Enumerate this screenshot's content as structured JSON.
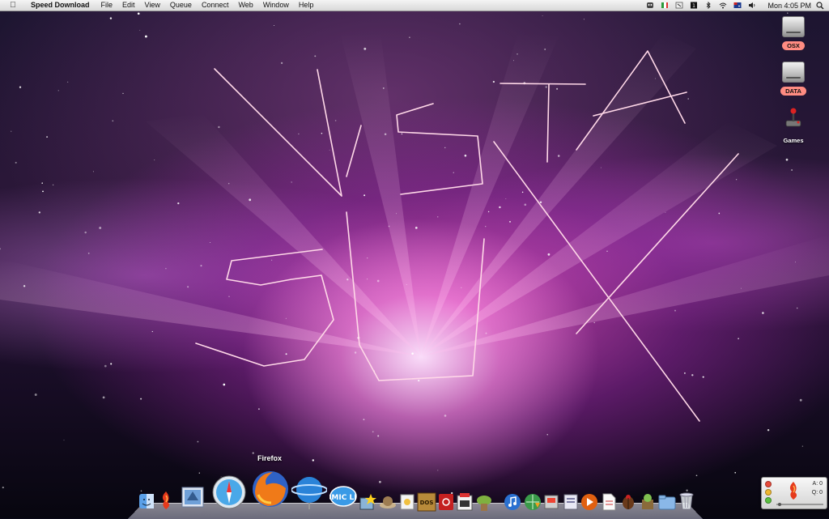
{
  "menubar": {
    "app_name": "Speed Download",
    "menus": [
      "File",
      "Edit",
      "View",
      "Queue",
      "Connect",
      "Web",
      "Window",
      "Help"
    ],
    "clock": "Mon 4:05 PM",
    "status_icons": [
      "robot-icon",
      "flag-icon",
      "script-icon",
      "black-square-icon",
      "bluetooth-icon",
      "wifi-icon",
      "australia-flag-icon",
      "volume-icon"
    ]
  },
  "desktop": {
    "icons": [
      {
        "name": "drive-osx",
        "label": "OSX",
        "type": "drive"
      },
      {
        "name": "drive-data",
        "label": "DATA",
        "type": "drive"
      },
      {
        "name": "games-folder",
        "label": "Games",
        "type": "joystick"
      }
    ],
    "wallpaper_handwriting": "VISTA SUX"
  },
  "dock": {
    "tooltip": "Firefox",
    "items": [
      {
        "name": "finder-icon"
      },
      {
        "name": "speed-download-icon"
      },
      {
        "name": "mail-icon"
      },
      {
        "name": "safari-icon"
      },
      {
        "name": "firefox-icon"
      },
      {
        "name": "network-globe-icon"
      },
      {
        "name": "comic-life-icon",
        "label": "COMIC LIFE"
      },
      {
        "name": "star-app-icon"
      },
      {
        "name": "hat-app-icon"
      },
      {
        "name": "preview-icon"
      },
      {
        "name": "dosbox-icon",
        "label": "DOS"
      },
      {
        "name": "red-app-icon"
      },
      {
        "name": "boxer-icon"
      },
      {
        "name": "yoda-app-icon"
      },
      {
        "name": "itunes-icon"
      },
      {
        "name": "globe-download-icon"
      },
      {
        "name": "system-tool-icon"
      },
      {
        "name": "utility-icon"
      },
      {
        "name": "media-player-icon"
      },
      {
        "name": "document-icon"
      },
      {
        "name": "bug-app-icon"
      },
      {
        "name": "extractor-icon"
      },
      {
        "name": "folder-icon"
      },
      {
        "name": "trash-icon"
      }
    ]
  },
  "speed_download_window": {
    "active_label": "A: 0",
    "queued_label": "Q: 0"
  },
  "colors": {
    "wallpaper_glow": "#e050c8",
    "writing_line": "#ffd8e8",
    "label_highlight": "#ff8c82"
  }
}
